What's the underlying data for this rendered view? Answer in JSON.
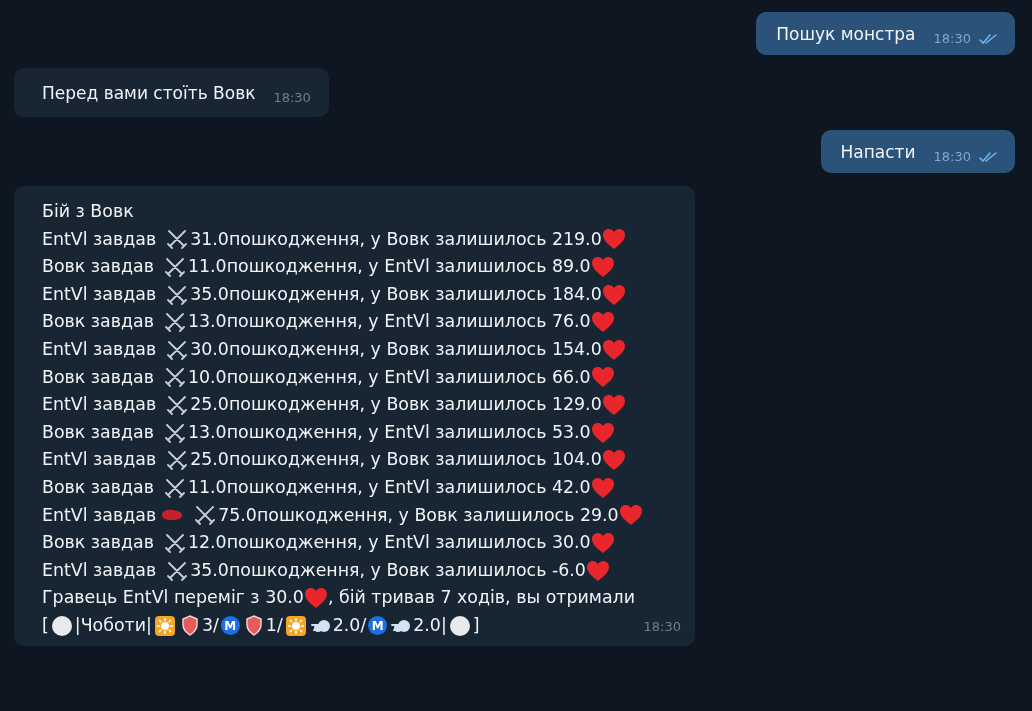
{
  "messages": [
    {
      "kind": "out",
      "text": "Пошук монстра",
      "time": "18:30",
      "read": true
    },
    {
      "kind": "in",
      "text": "Перед вами стоїть Вовк",
      "time": "18:30"
    },
    {
      "kind": "out",
      "text": "Напасти",
      "time": "18:30",
      "read": true
    },
    {
      "kind": "battle",
      "title": "Бій з Вовк",
      "time": "18:30",
      "lines": [
        {
          "attacker": "EntVl завдав",
          "crit": false,
          "damage": "31.0пошкодження, у Вовк залишилось 219.0"
        },
        {
          "attacker": "Вовк завдав",
          "crit": false,
          "damage": "11.0пошкодження, у EntVl залишилось 89.0"
        },
        {
          "attacker": "EntVl завдав",
          "crit": false,
          "damage": "35.0пошкодження, у Вовк залишилось 184.0"
        },
        {
          "attacker": "Вовк завдав",
          "crit": false,
          "damage": "13.0пошкодження, у EntVl залишилось 76.0"
        },
        {
          "attacker": "EntVl завдав",
          "crit": false,
          "damage": "30.0пошкодження, у Вовк залишилось 154.0"
        },
        {
          "attacker": "Вовк завдав",
          "crit": false,
          "damage": "10.0пошкодження, у EntVl залишилось 66.0"
        },
        {
          "attacker": "EntVl завдав",
          "crit": false,
          "damage": "25.0пошкодження, у Вовк залишилось 129.0"
        },
        {
          "attacker": "Вовк завдав",
          "crit": false,
          "damage": "13.0пошкодження, у EntVl залишилось 53.0"
        },
        {
          "attacker": "EntVl завдав",
          "crit": false,
          "damage": "25.0пошкодження, у Вовк залишилось 104.0"
        },
        {
          "attacker": "Вовк завдав",
          "crit": false,
          "damage": "11.0пошкодження, у EntVl залишилось 42.0"
        },
        {
          "attacker": "EntVl завдав",
          "crit": true,
          "damage": "75.0пошкодження, у Вовк залишилось 29.0"
        },
        {
          "attacker": "Вовк завдав",
          "crit": false,
          "damage": "12.0пошкодження, у EntVl залишилось 30.0"
        },
        {
          "attacker": "EntVl завдав",
          "crit": false,
          "damage": "35.0пошкодження, у Вовк залишилось -6.0"
        }
      ],
      "summary": [
        {
          "kind": "text",
          "text": "Гравець EntVl переміг з 30.0"
        },
        {
          "kind": "heart"
        },
        {
          "kind": "text",
          "text": ", бій тривав 7 ходів, вы отримали"
        }
      ],
      "reward": [
        {
          "kind": "text",
          "text": "["
        },
        {
          "kind": "pearl"
        },
        {
          "kind": "text",
          "text": "|Чоботи|"
        },
        {
          "kind": "sun"
        },
        {
          "kind": "shield"
        },
        {
          "kind": "text",
          "text": "3/"
        },
        {
          "kind": "metro",
          "text": "M"
        },
        {
          "kind": "shield"
        },
        {
          "kind": "text",
          "text": "1/"
        },
        {
          "kind": "sun"
        },
        {
          "kind": "dash"
        },
        {
          "kind": "text",
          "text": "2.0/"
        },
        {
          "kind": "metro",
          "text": "M"
        },
        {
          "kind": "dash"
        },
        {
          "kind": "text",
          "text": "2.0|"
        },
        {
          "kind": "pearl"
        },
        {
          "kind": "text",
          "text": "]"
        }
      ]
    }
  ]
}
